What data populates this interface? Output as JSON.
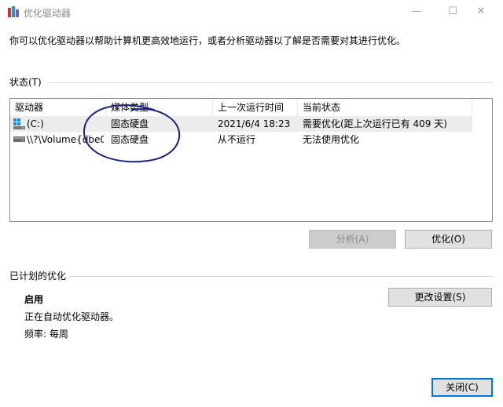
{
  "window": {
    "title": "优化驱动器",
    "controls": {
      "minimize": "—",
      "maximize": "☐",
      "close": "✕"
    }
  },
  "description": "你可以优化驱动器以帮助计算机更高效地运行，或者分析驱动器以了解是否需要对其进行优化。",
  "status_section": {
    "label": "状态(T)",
    "columns": [
      "驱动器",
      "媒体类型",
      "上一次运行时间",
      "当前状态"
    ],
    "rows": [
      {
        "drive": "(C:)",
        "media": "固态硬盘",
        "last_run": "2021/6/4 18:23",
        "status": "需要优化(距上次运行已有 409 天)",
        "icon": "windows-drive-icon"
      },
      {
        "drive": "\\\\?\\Volume{dbe0...",
        "media": "固态硬盘",
        "last_run": "从不运行",
        "status": "无法使用优化",
        "icon": "drive-icon"
      }
    ]
  },
  "actions": {
    "analyze": "分析(A)",
    "optimize": "优化(O)"
  },
  "schedule": {
    "label": "已计划的优化",
    "state": "启用",
    "detail": "正在自动优化驱动器。",
    "frequency": "频率: 每周",
    "change_settings": "更改设置(S)"
  },
  "footer": {
    "close": "关闭(C)"
  },
  "colors": {
    "accent": "#0078d7",
    "annotation_ink": "#1a237e"
  }
}
